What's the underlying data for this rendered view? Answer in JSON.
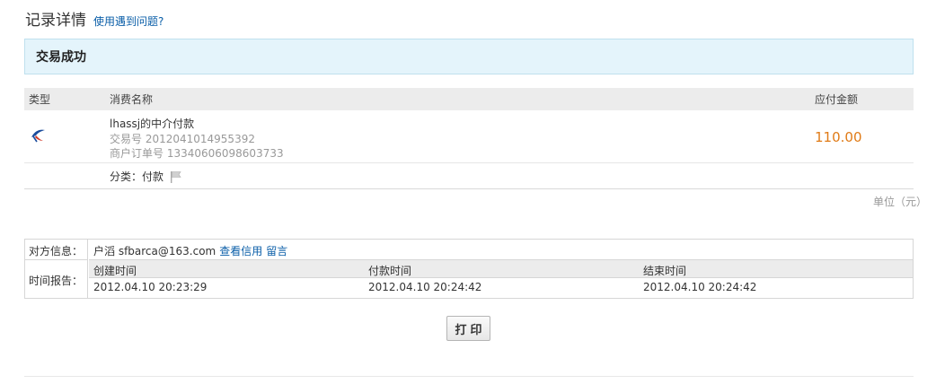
{
  "header": {
    "title": "记录详情",
    "help_link": "使用遇到问题?"
  },
  "status": {
    "text": "交易成功"
  },
  "table": {
    "columns": {
      "type": "类型",
      "name": "消费名称",
      "amount": "应付金额"
    },
    "row": {
      "icon": "alipay-swallow-icon",
      "name": "lhassj的中介付款",
      "trade_no": "交易号  2012041014955392",
      "order_no": "商户订单号  13340606098603733",
      "amount": "110.00",
      "category": "分类：付款",
      "category_icon": "flag-icon"
    },
    "unit": "单位（元）"
  },
  "info": {
    "party_label": "对方信息：",
    "party_name": "户滔  sfbarca@163.com",
    "credit_link": "查看信用",
    "message_link": "留言",
    "time_label": "时间报告：",
    "time_headers": [
      "创建时间",
      "付款时间",
      "结束时间"
    ],
    "time_values": [
      "2012.04.10 20:23:29",
      "2012.04.10 20:24:42",
      "2012.04.10 20:24:42"
    ]
  },
  "actions": {
    "print_label": "打印"
  },
  "colors": {
    "accent_link": "#0a5ea8",
    "amount": "#e07b17",
    "status_bg": "#e4f4fb"
  }
}
